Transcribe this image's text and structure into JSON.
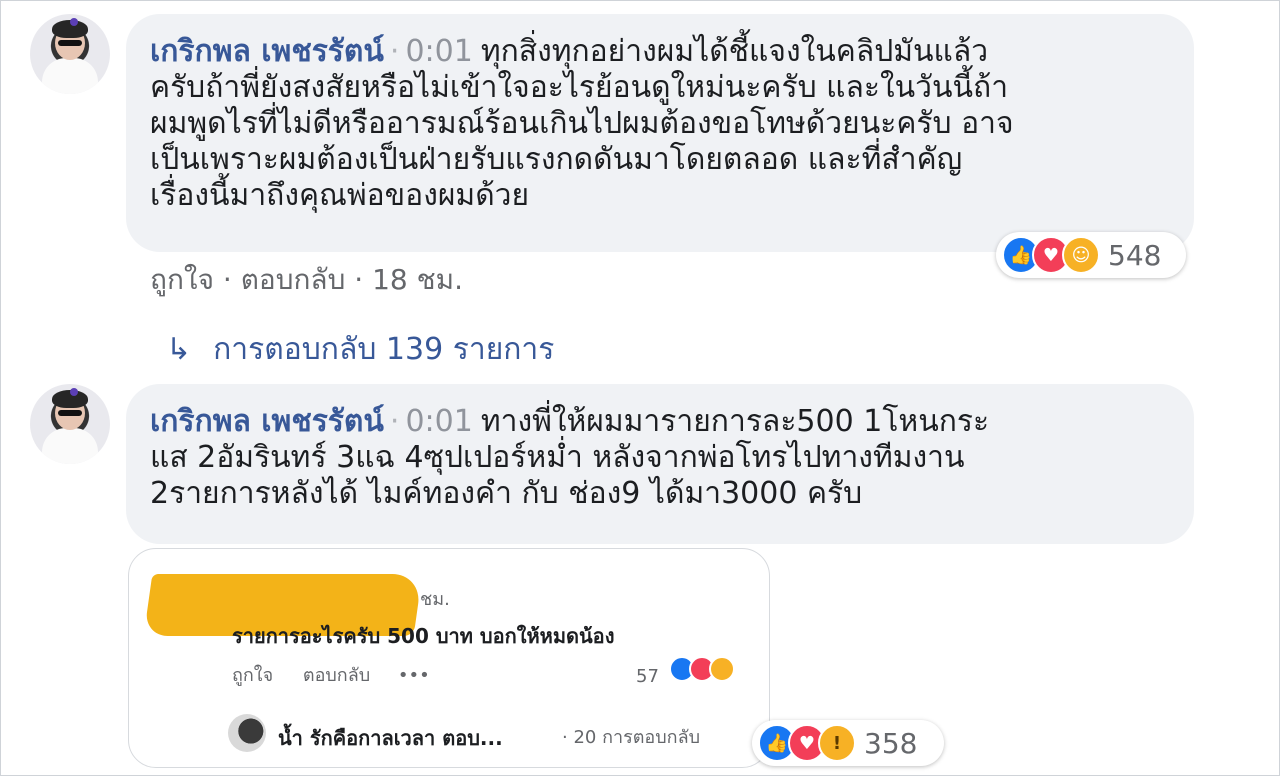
{
  "comment1": {
    "author": "เกริกพล เพชรรัตน์",
    "timestamp": "0:01",
    "lines": [
      "ทุกสิ่งทุกอย่างผมได้ชี้แจงในคลิปมันแล้ว",
      "ครับถ้าพี่ยังสงสัยหรือไม่เข้าใจอะไรย้อนดูใหม่นะครับ และในวันนี้ถ้า",
      "ผมพูดไรที่ไม่ดีหรืออารมณ์ร้อนเกินไปผมต้องขอโทษด้วยนะครับ อาจ",
      "เป็นเพราะผมต้องเป็นฝ่ายรับแรงกดดันมาโดยตลอด และที่สำคัญ",
      "เรื่องนี้มาถึงคุณพ่อของผมด้วย"
    ],
    "reaction_count": "548",
    "like": "ถูกใจ",
    "reply": "ตอบกลับ",
    "time": "18 ชม."
  },
  "replies_link": {
    "text": "การตอบกลับ 139 รายการ"
  },
  "comment2": {
    "author": "เกริกพล เพชรรัตน์",
    "timestamp": "0:01",
    "lines": [
      "ทางพี่ให้ผมมารายการละ500 1โหนกระ",
      "แส 2อัมรินทร์ 3แฉ 4ซุปเปอร์หม่ำ หลังจากพ่อโทรไปทางทีมงาน",
      "2รายการหลังได้ ไมค์ทองคำ กับ ช่อง9 ได้มา3000 ครับ"
    ],
    "reaction_count": "358"
  },
  "embedded": {
    "time_tail": "ชม.",
    "question": "รายการอะไรครับ 500 บาท บอกให้หมดน้อง",
    "like": "ถูกใจ",
    "reply": "ตอบกลับ",
    "more": "•••",
    "reaction_count": "57",
    "replier": "น้ำ รักคือกาลเวลา ตอบ...",
    "reply_meta": "· 20 การตอบกลับ"
  }
}
